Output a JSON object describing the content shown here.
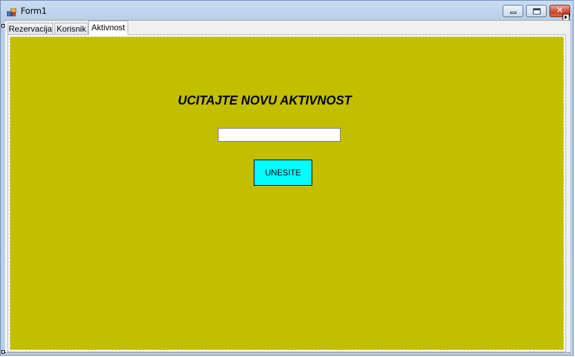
{
  "window": {
    "title": "Form1",
    "icon": "windows-form-icon",
    "controls": {
      "minimize_icon": "minimize-icon",
      "maximize_icon": "maximize-icon",
      "close_icon": "close-icon",
      "close_glyph": "✕"
    }
  },
  "tabs": [
    {
      "label": "Rezervacija",
      "selected": false
    },
    {
      "label": "Korisnik",
      "selected": false
    },
    {
      "label": "Aktivnost",
      "selected": true
    }
  ],
  "panel": {
    "background_color": "#c1bf00",
    "heading": "UCITAJTE NOVU AKTIVNOST",
    "input_value": "",
    "button_label": "UNESITE",
    "button_color": "#00ffff"
  }
}
